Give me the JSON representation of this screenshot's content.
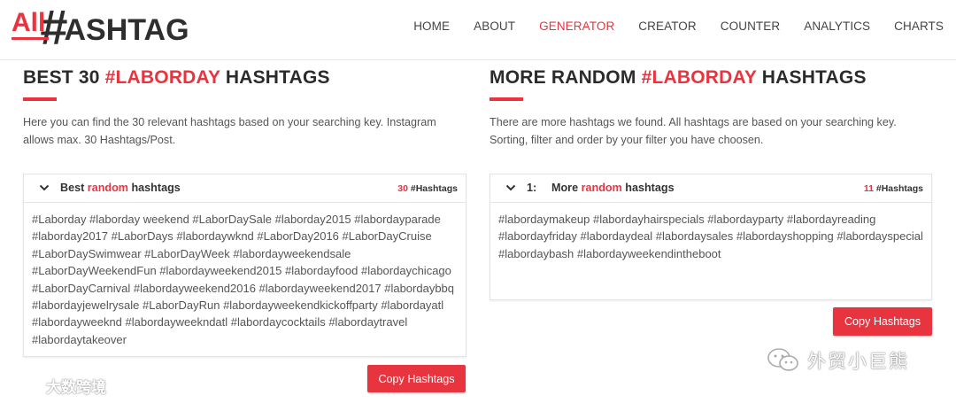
{
  "header": {
    "logo": {
      "all": "All",
      "hash": "#",
      "text": "ASHTAG"
    },
    "nav": [
      {
        "label": "HOME",
        "active": false
      },
      {
        "label": "ABOUT",
        "active": false
      },
      {
        "label": "GENERATOR",
        "active": true
      },
      {
        "label": "CREATOR",
        "active": false
      },
      {
        "label": "COUNTER",
        "active": false
      },
      {
        "label": "ANALYTICS",
        "active": false
      },
      {
        "label": "CHARTS",
        "active": false
      }
    ]
  },
  "left": {
    "title_pre": "BEST 30 ",
    "title_accent": "#LABORDAY",
    "title_post": " HASHTAGS",
    "description": "Here you can find the 30 relevant hashtags based on your searching key. Instagram allows max. 30 Hashtags/Post.",
    "card": {
      "title_pre": "Best ",
      "title_accent": "random",
      "title_post": " hashtags",
      "count_num": "30",
      "count_label": " #Hashtags",
      "hashtags": "#Laborday #laborday weekend #LaborDaySale #laborday2015 #labordayparade #laborday2017 #LaborDays #labordaywknd #LaborDay2016 #LaborDayCruise #LaborDaySwimwear #LaborDayWeek #labordayweekendsale #LaborDayWeekendFun #labordayweekend2015 #labordayfood #labordaychicago #LaborDayCarnival #labordayweekend2016 #labordayweekend2017 #labordaybbq #labordayjewelrysale #LaborDayRun #labordayweekendkickoffparty #labordayatl #labordayweeknd #labordayweekndatl #labordaycocktails #labordaytravel #labordaytakeover"
    },
    "button": "Copy Hashtags"
  },
  "right": {
    "title_pre": "MORE RANDOM ",
    "title_accent": "#LABORDAY",
    "title_post": " HASHTAGS",
    "description": "There are more hashtags we found. All hashtags are based on your searching key. Sorting, filter and order by your filter you have choosen.",
    "card": {
      "index": "1:",
      "title_pre": "More ",
      "title_accent": "random",
      "title_post": " hashtags",
      "count_num": "11",
      "count_label": " #Hashtags",
      "hashtags": "#labordaymakeup #labordayhairspecials #labordayparty #labordayreading #labordayfriday #labordaydeal #labordaysales #labordayshopping #labordayspecial #labordaybash #labordayweekendintheboot"
    },
    "button": "Copy Hashtags"
  },
  "watermarks": {
    "left": "大数跨境",
    "right": "外贸小巨熊"
  },
  "colors": {
    "accent": "#e8343f",
    "text": "#333333"
  }
}
